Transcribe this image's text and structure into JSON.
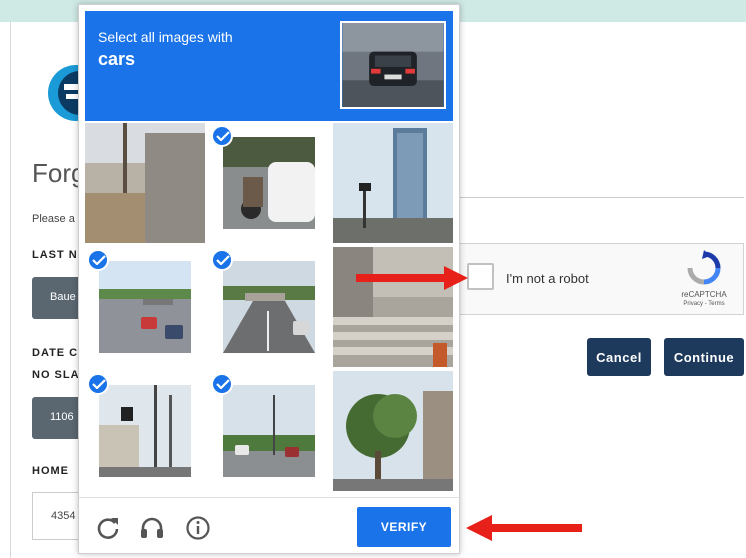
{
  "page": {
    "title": "Forg",
    "instructions": "Please a",
    "fields": [
      {
        "label": "LAST N",
        "value": "Baue"
      },
      {
        "label": "DATE C",
        "value": ""
      },
      {
        "label": "NO SLA",
        "value": "1106"
      },
      {
        "label": "HOME",
        "value": "4354"
      }
    ],
    "cancel_label": "Cancel",
    "continue_label": "Continue"
  },
  "recaptcha": {
    "checkbox_label": "I'm not a robot",
    "brand": "reCAPTCHA",
    "links": "Privacy - Terms"
  },
  "challenge": {
    "prompt_line1": "Select all images with",
    "prompt_target": "cars",
    "verify_label": "VERIFY",
    "tiles": [
      {
        "name": "building-pole",
        "selected": false
      },
      {
        "name": "street-white-car",
        "selected": true
      },
      {
        "name": "tall-building",
        "selected": false
      },
      {
        "name": "highway-cars",
        "selected": true
      },
      {
        "name": "road-overpass",
        "selected": true
      },
      {
        "name": "concrete-stairs",
        "selected": false
      },
      {
        "name": "street-poles",
        "selected": true
      },
      {
        "name": "intersection-cars",
        "selected": true
      },
      {
        "name": "tree-street",
        "selected": false
      }
    ],
    "footer_icons": [
      "reload-icon",
      "audio-icon",
      "info-icon"
    ]
  },
  "colors": {
    "accent": "#1a73e8",
    "dark_button": "#1d3a5c",
    "arrow": "#e8201a"
  }
}
